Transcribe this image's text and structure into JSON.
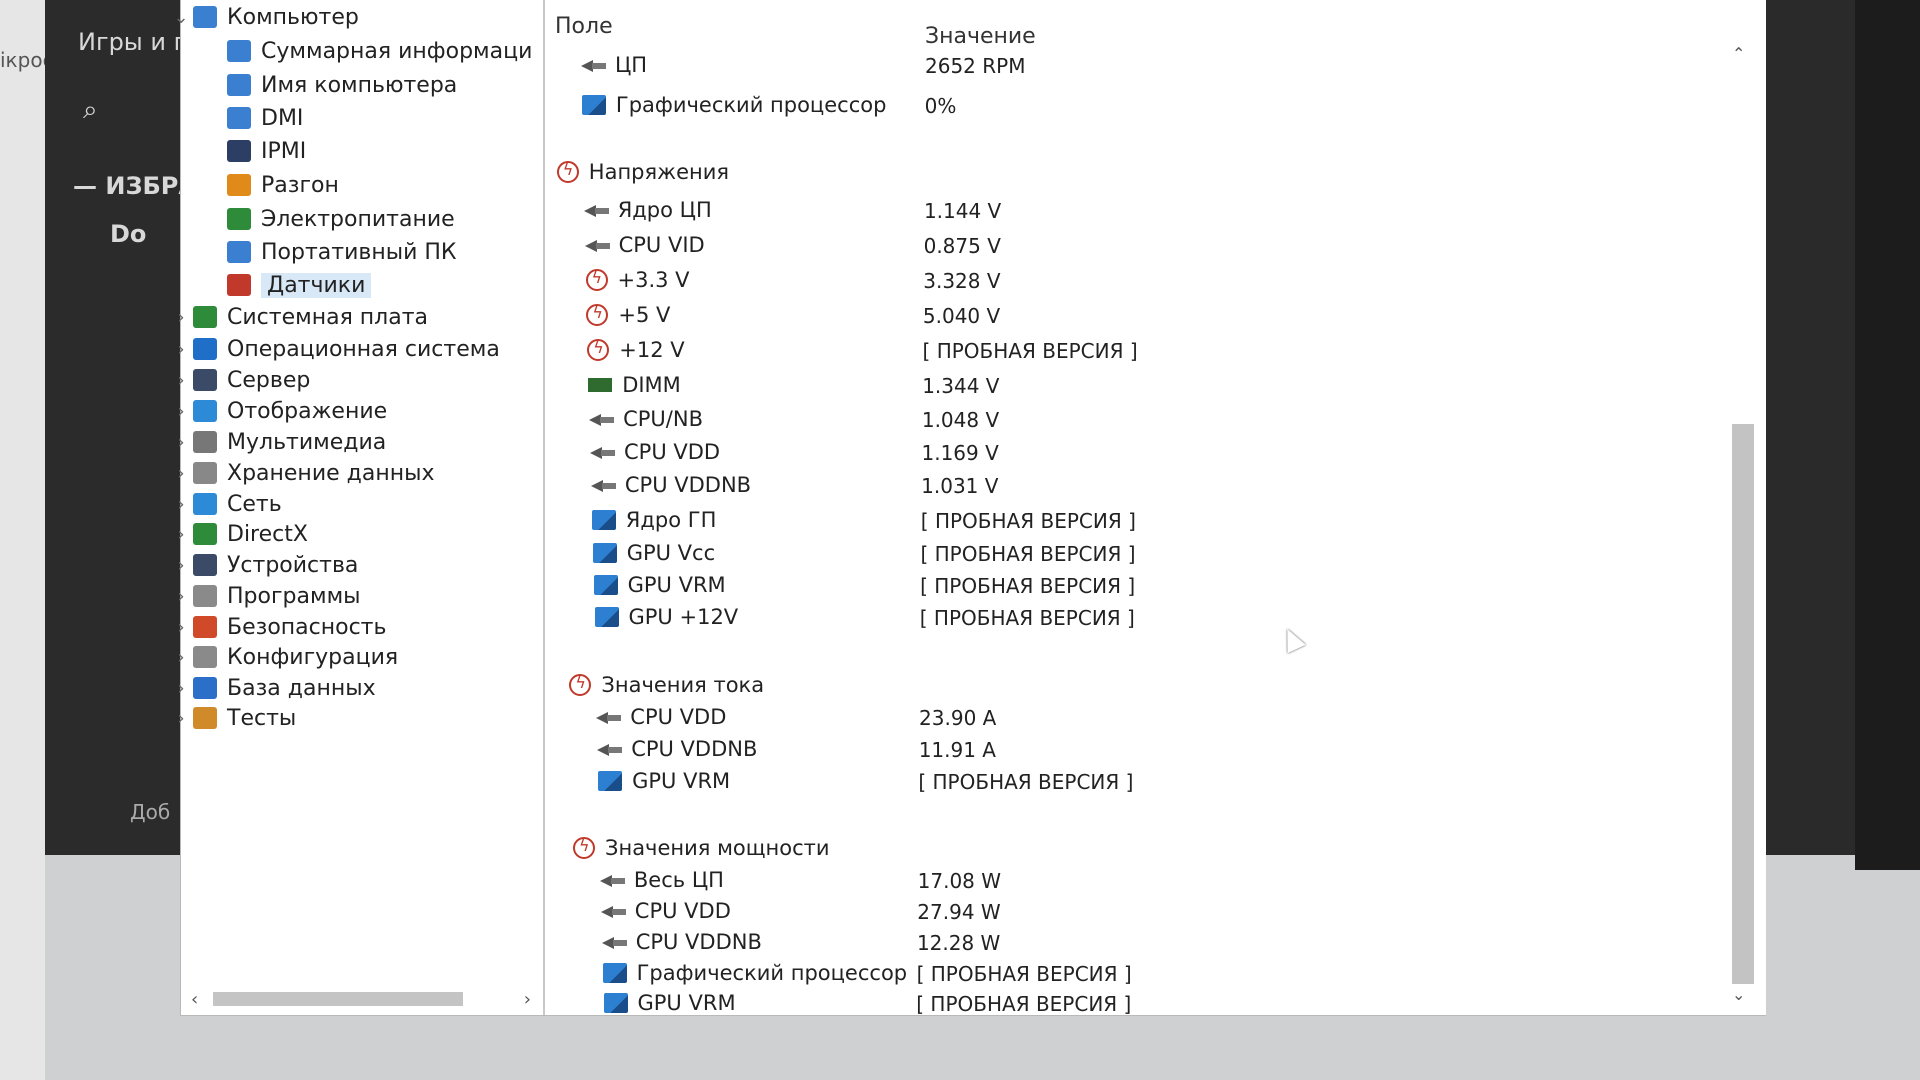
{
  "background_app": {
    "edge_text": "ікрос",
    "title": "Игры и п",
    "section": "— ИЗБРА",
    "item": "Do",
    "bottom_item": "Доб"
  },
  "tree": {
    "items": [
      {
        "label": "Компьютер",
        "level": 0,
        "expanded": true,
        "icon": "computer-icon",
        "color": "#3a7fd0"
      },
      {
        "label": "Суммарная информаци",
        "level": 1,
        "icon": "summary-icon",
        "color": "#3a7fd0"
      },
      {
        "label": "Имя компьютера",
        "level": 1,
        "icon": "computer-name-icon",
        "color": "#3a7fd0"
      },
      {
        "label": "DMI",
        "level": 1,
        "icon": "dmi-icon",
        "color": "#3a7fd0"
      },
      {
        "label": "IPMI",
        "level": 1,
        "icon": "ipmi-icon",
        "color": "#2c3e63"
      },
      {
        "label": "Разгон",
        "level": 1,
        "icon": "overclock-icon",
        "color": "#e08a1a"
      },
      {
        "label": "Электропитание",
        "level": 1,
        "icon": "power-icon",
        "color": "#2e8b3a"
      },
      {
        "label": "Портативный ПК",
        "level": 1,
        "icon": "laptop-icon",
        "color": "#3a7fd0"
      },
      {
        "label": "Датчики",
        "level": 1,
        "selected": true,
        "icon": "sensors-icon",
        "color": "#c0392b"
      },
      {
        "label": "Системная плата",
        "level": 0,
        "icon": "motherboard-icon",
        "color": "#2e8b3a"
      },
      {
        "label": "Операционная система",
        "level": 0,
        "icon": "windows-icon",
        "color": "#1f6fc8"
      },
      {
        "label": "Сервер",
        "level": 0,
        "icon": "server-icon",
        "color": "#3b4a66"
      },
      {
        "label": "Отображение",
        "level": 0,
        "icon": "display-icon",
        "color": "#2c8ad6"
      },
      {
        "label": "Мультимедиа",
        "level": 0,
        "icon": "multimedia-icon",
        "color": "#777777"
      },
      {
        "label": "Хранение данных",
        "level": 0,
        "icon": "storage-icon",
        "color": "#888888"
      },
      {
        "label": "Сеть",
        "level": 0,
        "icon": "network-icon",
        "color": "#2c8ad6"
      },
      {
        "label": "DirectX",
        "level": 0,
        "icon": "directx-icon",
        "color": "#2e8b3a"
      },
      {
        "label": "Устройства",
        "level": 0,
        "icon": "devices-icon",
        "color": "#3b4a66"
      },
      {
        "label": "Программы",
        "level": 0,
        "icon": "programs-icon",
        "color": "#8a8a8a"
      },
      {
        "label": "Безопасность",
        "level": 0,
        "icon": "security-icon",
        "color": "#d04a2a"
      },
      {
        "label": "Конфигурация",
        "level": 0,
        "icon": "configuration-icon",
        "color": "#8a8a8a"
      },
      {
        "label": "База данных",
        "level": 0,
        "icon": "database-icon",
        "color": "#2c6fc8"
      },
      {
        "label": "Тесты",
        "level": 0,
        "icon": "tests-icon",
        "color": "#d08a2a"
      }
    ]
  },
  "list": {
    "col_field": "Поле",
    "col_value": "Значение",
    "rows": [
      {
        "type": "item",
        "icon": "arrow",
        "label": "ЦП",
        "value": "2652 RPM"
      },
      {
        "type": "item",
        "icon": "gpu",
        "label": "Графический процессор",
        "value": "0%"
      },
      {
        "type": "group",
        "icon": "volt",
        "label": "Напряжения"
      },
      {
        "type": "item",
        "icon": "arrow",
        "label": "Ядро ЦП",
        "value": "1.144 V"
      },
      {
        "type": "item",
        "icon": "arrow",
        "label": "CPU VID",
        "value": "0.875 V"
      },
      {
        "type": "item",
        "icon": "volt",
        "label": "+3.3 V",
        "value": "3.328 V"
      },
      {
        "type": "item",
        "icon": "volt",
        "label": "+5 V",
        "value": "5.040 V"
      },
      {
        "type": "item",
        "icon": "volt",
        "label": "+12 V",
        "value": "[ ПРОБНАЯ ВЕРСИЯ ]"
      },
      {
        "type": "item",
        "icon": "dimm",
        "label": "DIMM",
        "value": "1.344 V"
      },
      {
        "type": "item",
        "icon": "arrow",
        "label": "CPU/NB",
        "value": "1.048 V"
      },
      {
        "type": "item",
        "icon": "arrow",
        "label": "CPU VDD",
        "value": "1.169 V"
      },
      {
        "type": "item",
        "icon": "arrow",
        "label": "CPU VDDNB",
        "value": "1.031 V"
      },
      {
        "type": "item",
        "icon": "gpu",
        "label": "Ядро ГП",
        "value": "[ ПРОБНАЯ ВЕРСИЯ ]"
      },
      {
        "type": "item",
        "icon": "gpu",
        "label": "GPU Vcc",
        "value": "[ ПРОБНАЯ ВЕРСИЯ ]"
      },
      {
        "type": "item",
        "icon": "gpu",
        "label": "GPU VRM",
        "value": "[ ПРОБНАЯ ВЕРСИЯ ]"
      },
      {
        "type": "item",
        "icon": "gpu",
        "label": "GPU +12V",
        "value": "[ ПРОБНАЯ ВЕРСИЯ ]"
      },
      {
        "type": "group",
        "icon": "volt",
        "label": "Значения тока"
      },
      {
        "type": "item",
        "icon": "arrow",
        "label": "CPU VDD",
        "value": "23.90 A"
      },
      {
        "type": "item",
        "icon": "arrow",
        "label": "CPU VDDNB",
        "value": "11.91 A"
      },
      {
        "type": "item",
        "icon": "gpu",
        "label": "GPU VRM",
        "value": "[ ПРОБНАЯ ВЕРСИЯ ]"
      },
      {
        "type": "group",
        "icon": "volt",
        "label": "Значения мощности"
      },
      {
        "type": "item",
        "icon": "arrow",
        "label": "Весь ЦП",
        "value": "17.08 W"
      },
      {
        "type": "item",
        "icon": "arrow",
        "label": "CPU VDD",
        "value": "27.94 W"
      },
      {
        "type": "item",
        "icon": "arrow",
        "label": "CPU VDDNB",
        "value": "12.28 W"
      },
      {
        "type": "item",
        "icon": "gpu",
        "label": "Графический процессор",
        "value": "[ ПРОБНАЯ ВЕРСИЯ ]"
      },
      {
        "type": "item",
        "icon": "gpu",
        "label": "GPU VRM",
        "value": "[ ПРОБНАЯ ВЕРСИЯ ]"
      }
    ]
  },
  "scroll": {
    "left_arrow": "‹",
    "right_arrow": "›",
    "up_arrow": "⌃",
    "down_arrow": "⌄"
  }
}
